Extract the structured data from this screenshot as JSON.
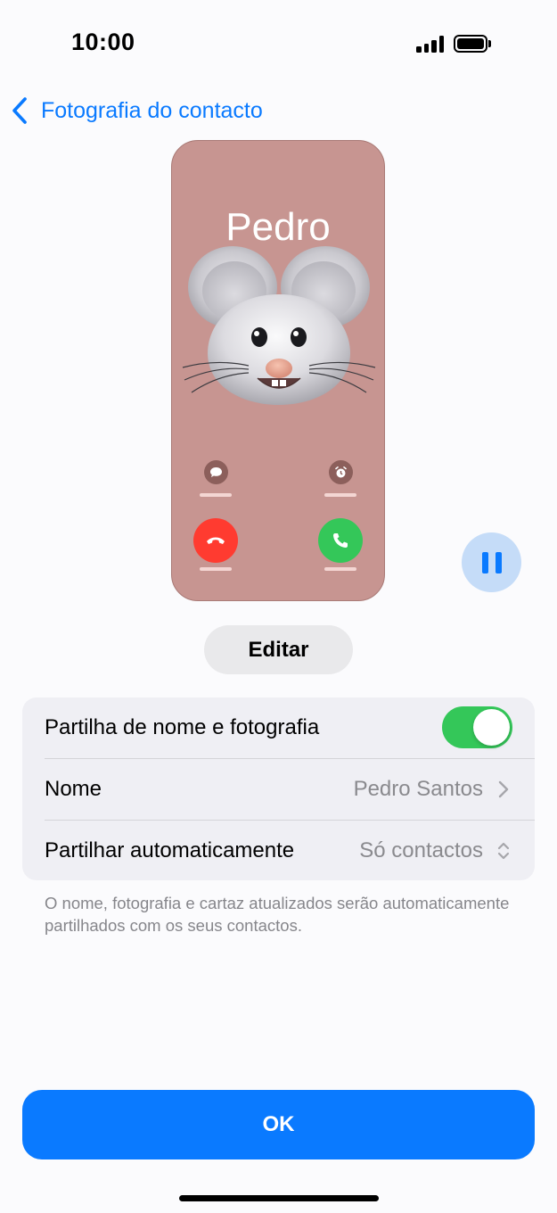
{
  "status_bar": {
    "time": "10:00",
    "icons": [
      "cellular-signal-icon",
      "battery-icon"
    ]
  },
  "nav": {
    "back_label": "Fotografia do contacto",
    "back_icon": "chevron-left-icon",
    "accent_color": "#0a7aff"
  },
  "poster_preview": {
    "name": "Pedro",
    "background_color": "#c79591",
    "memoji": "mouse-memoji",
    "small_actions": [
      "message-icon",
      "alarm-icon"
    ],
    "call_actions": [
      "decline-call-icon",
      "accept-call-icon"
    ]
  },
  "playback": {
    "icon": "pause-icon"
  },
  "edit_button": {
    "label": "Editar"
  },
  "settings": {
    "rows": [
      {
        "label": "Partilha de nome e fotografia",
        "toggle_on": true
      },
      {
        "label": "Nome",
        "value": "Pedro Santos",
        "accessory": "chevron-right-icon"
      },
      {
        "label": "Partilhar automaticamente",
        "value": "Só contactos",
        "accessory": "chevron-up-down-icon"
      }
    ]
  },
  "footnote": "O nome, fotografia e cartaz atualizados serão automaticamente partilhados com os seus contactos.",
  "ok_button": {
    "label": "OK",
    "color": "#0a7aff"
  }
}
